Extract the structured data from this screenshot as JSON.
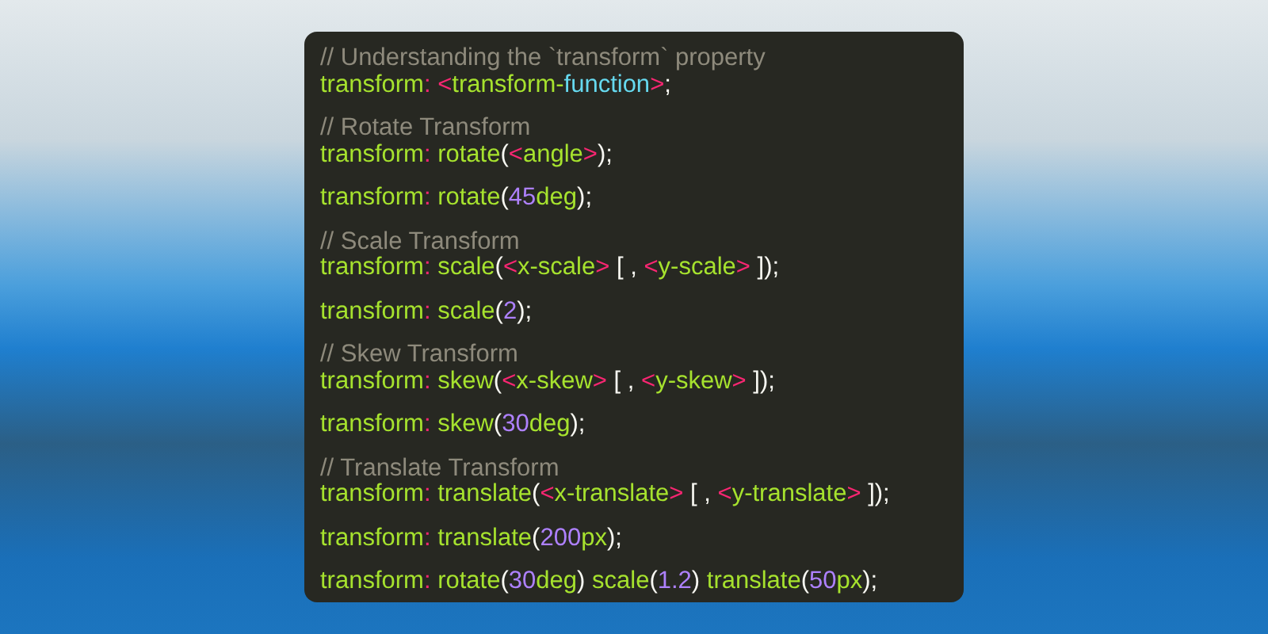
{
  "code_groups": [
    {
      "lines": [
        [
          {
            "kind": "comment",
            "text": "// Understanding the `transform` property"
          }
        ],
        [
          {
            "kind": "name",
            "text": "transform"
          },
          {
            "kind": "op",
            "text": ": <"
          },
          {
            "kind": "name",
            "text": "transform-"
          },
          {
            "kind": "keyword",
            "text": "function"
          },
          {
            "kind": "op",
            "text": ">"
          },
          {
            "kind": "punct",
            "text": ";"
          }
        ]
      ]
    },
    {
      "lines": [
        [
          {
            "kind": "comment",
            "text": "// Rotate Transform"
          }
        ],
        [
          {
            "kind": "name",
            "text": "transform"
          },
          {
            "kind": "op",
            "text": ": "
          },
          {
            "kind": "name",
            "text": "rotate"
          },
          {
            "kind": "punct",
            "text": "("
          },
          {
            "kind": "op",
            "text": "<"
          },
          {
            "kind": "name",
            "text": "angle"
          },
          {
            "kind": "op",
            "text": ">"
          },
          {
            "kind": "punct",
            "text": ");"
          }
        ]
      ]
    },
    {
      "lines": [
        [
          {
            "kind": "name",
            "text": "transform"
          },
          {
            "kind": "op",
            "text": ": "
          },
          {
            "kind": "name",
            "text": "rotate"
          },
          {
            "kind": "punct",
            "text": "("
          },
          {
            "kind": "number",
            "text": "45"
          },
          {
            "kind": "name",
            "text": "deg"
          },
          {
            "kind": "punct",
            "text": ");"
          }
        ]
      ]
    },
    {
      "lines": [
        [
          {
            "kind": "comment",
            "text": "// Scale Transform"
          }
        ],
        [
          {
            "kind": "name",
            "text": "transform"
          },
          {
            "kind": "op",
            "text": ": "
          },
          {
            "kind": "name",
            "text": "scale"
          },
          {
            "kind": "punct",
            "text": "("
          },
          {
            "kind": "op",
            "text": "<"
          },
          {
            "kind": "name",
            "text": "x-scale"
          },
          {
            "kind": "op",
            "text": ">"
          },
          {
            "kind": "punct",
            "text": " [ , "
          },
          {
            "kind": "op",
            "text": "<"
          },
          {
            "kind": "name",
            "text": "y-scale"
          },
          {
            "kind": "op",
            "text": ">"
          },
          {
            "kind": "punct",
            "text": " ]);"
          }
        ]
      ]
    },
    {
      "lines": [
        [
          {
            "kind": "name",
            "text": "transform"
          },
          {
            "kind": "op",
            "text": ": "
          },
          {
            "kind": "name",
            "text": "scale"
          },
          {
            "kind": "punct",
            "text": "("
          },
          {
            "kind": "number",
            "text": "2"
          },
          {
            "kind": "punct",
            "text": ");"
          }
        ]
      ]
    },
    {
      "lines": [
        [
          {
            "kind": "comment",
            "text": "// Skew Transform"
          }
        ],
        [
          {
            "kind": "name",
            "text": "transform"
          },
          {
            "kind": "op",
            "text": ": "
          },
          {
            "kind": "name",
            "text": "skew"
          },
          {
            "kind": "punct",
            "text": "("
          },
          {
            "kind": "op",
            "text": "<"
          },
          {
            "kind": "name",
            "text": "x-skew"
          },
          {
            "kind": "op",
            "text": ">"
          },
          {
            "kind": "punct",
            "text": " [ , "
          },
          {
            "kind": "op",
            "text": "<"
          },
          {
            "kind": "name",
            "text": "y-skew"
          },
          {
            "kind": "op",
            "text": ">"
          },
          {
            "kind": "punct",
            "text": " ]);"
          }
        ]
      ]
    },
    {
      "lines": [
        [
          {
            "kind": "name",
            "text": "transform"
          },
          {
            "kind": "op",
            "text": ": "
          },
          {
            "kind": "name",
            "text": "skew"
          },
          {
            "kind": "punct",
            "text": "("
          },
          {
            "kind": "number",
            "text": "30"
          },
          {
            "kind": "name",
            "text": "deg"
          },
          {
            "kind": "punct",
            "text": ");"
          }
        ]
      ]
    },
    {
      "lines": [
        [
          {
            "kind": "comment",
            "text": "// Translate Transform"
          }
        ],
        [
          {
            "kind": "name",
            "text": "transform"
          },
          {
            "kind": "op",
            "text": ": "
          },
          {
            "kind": "name",
            "text": "translate"
          },
          {
            "kind": "punct",
            "text": "("
          },
          {
            "kind": "op",
            "text": "<"
          },
          {
            "kind": "name",
            "text": "x-translate"
          },
          {
            "kind": "op",
            "text": ">"
          },
          {
            "kind": "punct",
            "text": " [ , "
          },
          {
            "kind": "op",
            "text": "<"
          },
          {
            "kind": "name",
            "text": "y-translate"
          },
          {
            "kind": "op",
            "text": ">"
          },
          {
            "kind": "punct",
            "text": " ]);"
          }
        ]
      ]
    },
    {
      "lines": [
        [
          {
            "kind": "name",
            "text": "transform"
          },
          {
            "kind": "op",
            "text": ": "
          },
          {
            "kind": "name",
            "text": "translate"
          },
          {
            "kind": "punct",
            "text": "("
          },
          {
            "kind": "number",
            "text": "200"
          },
          {
            "kind": "name",
            "text": "px"
          },
          {
            "kind": "punct",
            "text": ");"
          }
        ]
      ]
    },
    {
      "lines": [
        [
          {
            "kind": "name",
            "text": "transform"
          },
          {
            "kind": "op",
            "text": ": "
          },
          {
            "kind": "name",
            "text": "rotate"
          },
          {
            "kind": "punct",
            "text": "("
          },
          {
            "kind": "number",
            "text": "30"
          },
          {
            "kind": "name",
            "text": "deg"
          },
          {
            "kind": "punct",
            "text": ") "
          },
          {
            "kind": "name",
            "text": "scale"
          },
          {
            "kind": "punct",
            "text": "("
          },
          {
            "kind": "number",
            "text": "1.2"
          },
          {
            "kind": "punct",
            "text": ") "
          },
          {
            "kind": "name",
            "text": "translate"
          },
          {
            "kind": "punct",
            "text": "("
          },
          {
            "kind": "number",
            "text": "50"
          },
          {
            "kind": "name",
            "text": "px"
          },
          {
            "kind": "punct",
            "text": ");"
          }
        ]
      ]
    }
  ]
}
